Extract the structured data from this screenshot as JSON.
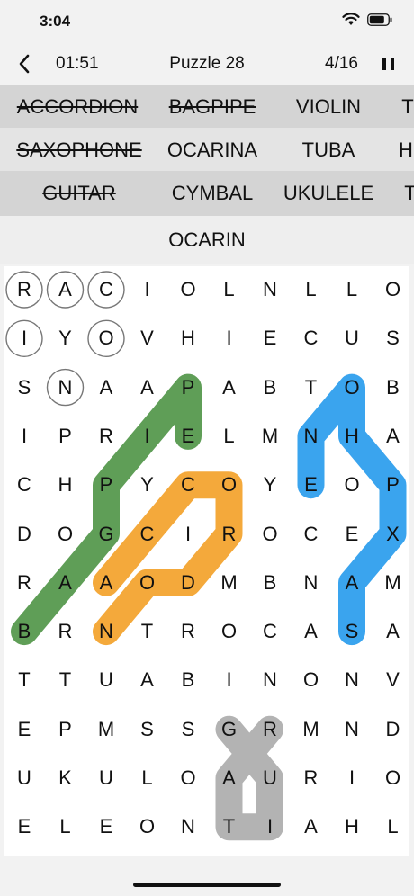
{
  "status": {
    "time": "3:04"
  },
  "header": {
    "timer": "01:51",
    "title": "Puzzle 28",
    "progress": "4/16"
  },
  "word_bank": [
    [
      {
        "text": "ACCORDION",
        "found": true
      },
      {
        "text": "BAGPIPE",
        "found": true
      },
      {
        "text": "VIOLIN",
        "found": false
      },
      {
        "text": "T",
        "found": false
      }
    ],
    [
      {
        "text": "SAXOPHONE",
        "found": true
      },
      {
        "text": "OCARINA",
        "found": false
      },
      {
        "text": "TUBA",
        "found": false
      },
      {
        "text": "H",
        "found": false
      }
    ],
    [
      {
        "text": "GUITAR",
        "found": true
      },
      {
        "text": "CYMBAL",
        "found": false
      },
      {
        "text": "UKULELE",
        "found": false
      },
      {
        "text": "T",
        "found": false
      }
    ]
  ],
  "current_word": "OCARIN",
  "grid": [
    "RACIOLNLLO",
    "IYOVHIECUS",
    "SNAAPABTOB",
    "IPRIELMNHA",
    "CHPYCOYEOP",
    "DOGCIROCEX",
    "RAAODMBNAM",
    "BRNTROCASA",
    "TTUABINONV",
    "EPMSSGRMND",
    "UKULOAURIO",
    "ELEONTIAHL"
  ],
  "selection_circles": [
    [
      0,
      0
    ],
    [
      0,
      1
    ],
    [
      0,
      2
    ],
    [
      1,
      0
    ],
    [
      1,
      2
    ],
    [
      2,
      1
    ]
  ],
  "found_paths": [
    {
      "word": "BAGPIPE",
      "color": "#5f9e57",
      "cells": [
        [
          7,
          0
        ],
        [
          6,
          1
        ],
        [
          5,
          2
        ],
        [
          4,
          2
        ],
        [
          3,
          3
        ],
        [
          2,
          4
        ],
        [
          3,
          4
        ]
      ]
    },
    {
      "word": "ACCORDION",
      "color": "#f4a93b",
      "cells": [
        [
          6,
          2
        ],
        [
          5,
          3
        ],
        [
          4,
          4
        ],
        [
          4,
          5
        ],
        [
          5,
          5
        ],
        [
          6,
          4
        ],
        [
          6,
          3
        ],
        [
          7,
          2
        ]
      ]
    },
    {
      "word": "SAXOPHONE",
      "color": "#3aa4ee",
      "cells": [
        [
          7,
          8
        ],
        [
          6,
          8
        ],
        [
          5,
          9
        ],
        [
          4,
          9
        ],
        [
          3,
          8
        ],
        [
          2,
          8
        ],
        [
          3,
          7
        ],
        [
          4,
          7
        ]
      ]
    },
    {
      "word": "GUITAR",
      "color": "#b3b3b3",
      "cells": [
        [
          9,
          5
        ],
        [
          10,
          6
        ],
        [
          11,
          6
        ],
        [
          11,
          5
        ],
        [
          10,
          5
        ],
        [
          9,
          6
        ]
      ]
    }
  ]
}
